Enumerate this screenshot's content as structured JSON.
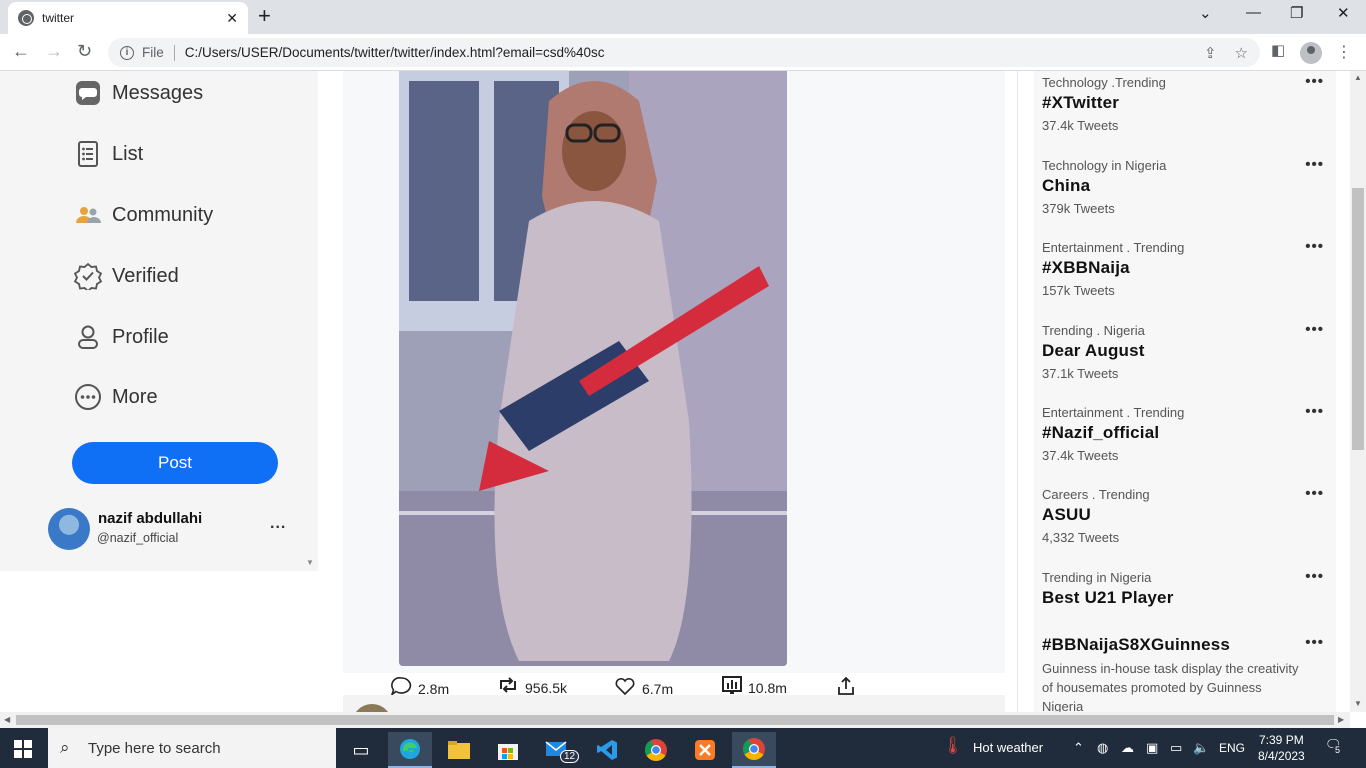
{
  "browser": {
    "tab_title": "twitter",
    "url": "C:/Users/USER/Documents/twitter/twitter/index.html?email=csd%40sc",
    "url_scheme_label": "File"
  },
  "sidebar": {
    "items": [
      {
        "label": "Messages",
        "icon": "message-icon"
      },
      {
        "label": "List",
        "icon": "list-icon"
      },
      {
        "label": "Community",
        "icon": "community-icon"
      },
      {
        "label": "Verified",
        "icon": "verified-icon"
      },
      {
        "label": "Profile",
        "icon": "profile-icon"
      },
      {
        "label": "More",
        "icon": "more-icon"
      }
    ],
    "post_label": "Post",
    "user": {
      "name": "nazif abdullahi",
      "handle": "@nazif_official",
      "more": "..."
    }
  },
  "tweet": {
    "stats": {
      "replies": "2.8m",
      "retweets": "956.5k",
      "likes": "6.7m",
      "views": "10.8m"
    }
  },
  "trends": [
    {
      "category": "Technology .Trending",
      "name": "#XTwitter",
      "count": "37.4k Tweets"
    },
    {
      "category": "Technology in Nigeria",
      "name": "China",
      "count": "379k Tweets"
    },
    {
      "category": "Entertainment . Trending",
      "name": "#XBBNaija",
      "count": "157k Tweets"
    },
    {
      "category": "Trending . Nigeria",
      "name": "Dear August",
      "count": "37.1k Tweets"
    },
    {
      "category": "Entertainment . Trending",
      "name": "#Nazif_official",
      "count": "37.4k Tweets"
    },
    {
      "category": "Careers . Trending",
      "name": "ASUU",
      "count": "4,332 Tweets"
    },
    {
      "category": "Trending in Nigeria",
      "name": "Best U21 Player",
      "count": ""
    },
    {
      "category": "",
      "name": "#BBNaijaS8XGuinness",
      "count": "",
      "description": "Guinness in-house task display the creativity of housemates promoted by Guinness Nigeria"
    }
  ],
  "taskbar": {
    "search_placeholder": "Type here to search",
    "weather": "Hot weather",
    "language": "ENG",
    "time": "7:39 PM",
    "date": "8/4/2023",
    "mail_badge": "12",
    "notification_count": "5"
  },
  "colors": {
    "post_button": "#0f6ff5",
    "taskbar": "#202c3c"
  }
}
